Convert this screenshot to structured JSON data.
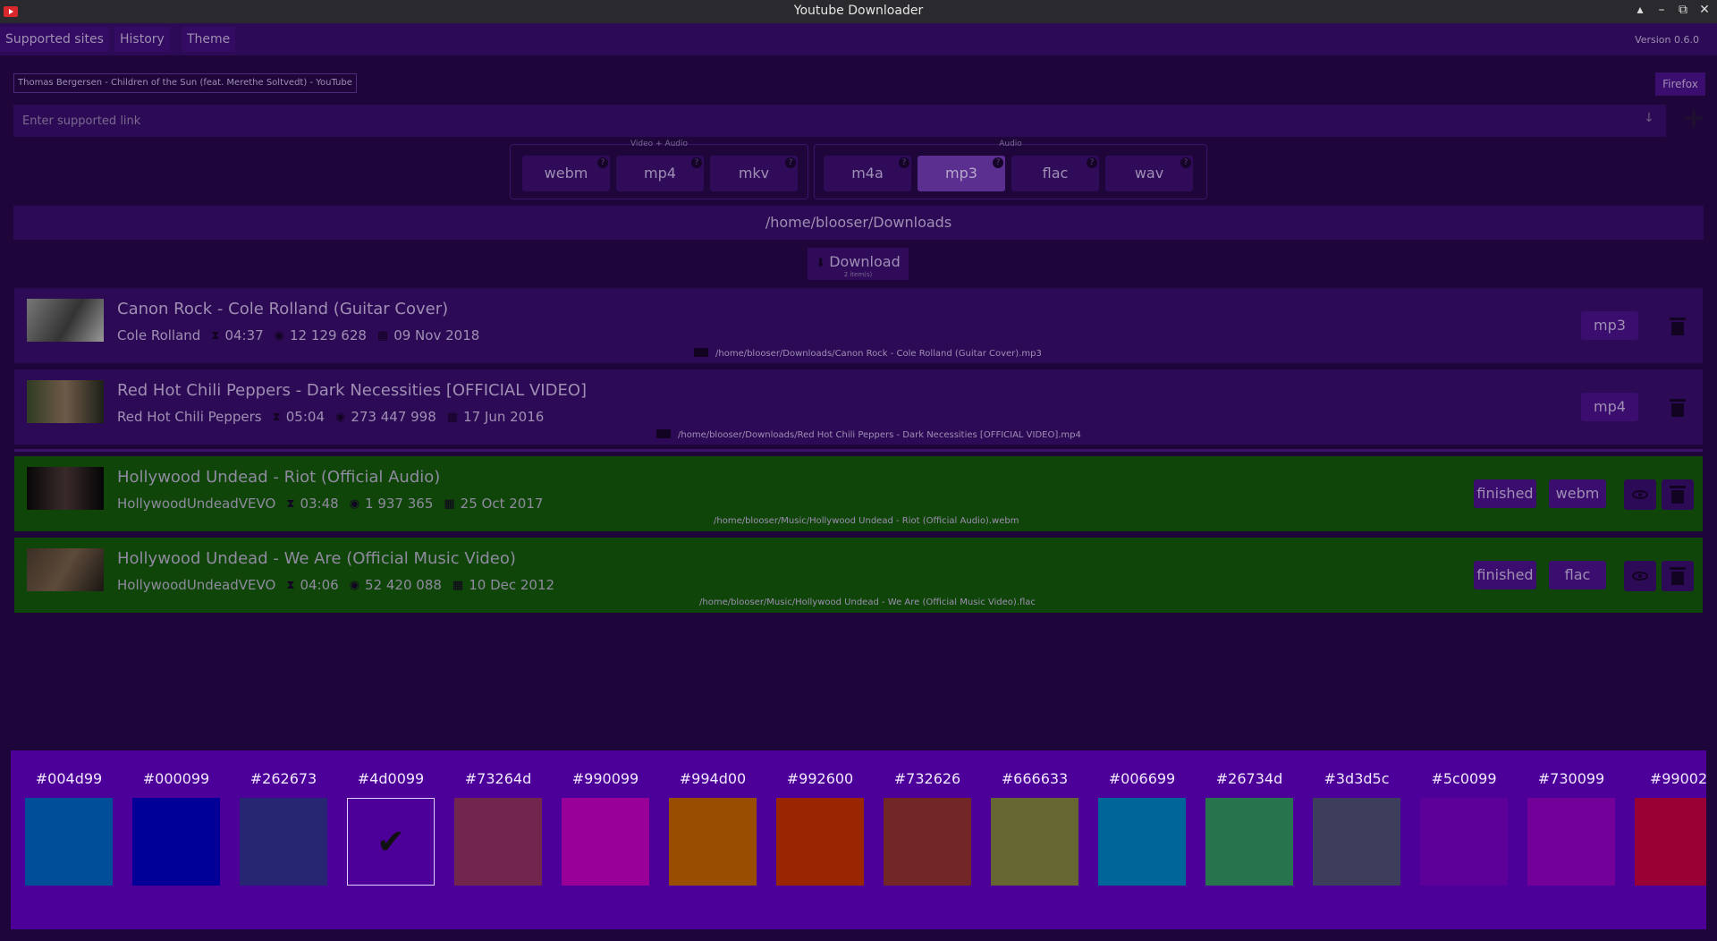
{
  "window": {
    "title": "Youtube Downloader"
  },
  "menu": {
    "supported_sites": "Supported sites",
    "history": "History",
    "theme": "Theme",
    "version": "Version 0.6.0"
  },
  "cookies": {
    "file": "Thomas Bergersen - Children of the Sun (feat. Merethe Soltvedt) - YouTube",
    "browser": "Firefox"
  },
  "link_input": {
    "placeholder": "Enter supported link",
    "value": "",
    "add_label": "+"
  },
  "formats": {
    "video_audio_label": "Video + Audio",
    "audio_label": "Audio",
    "video": [
      "webm",
      "mp4",
      "mkv"
    ],
    "audio": [
      "m4a",
      "mp3",
      "flac",
      "wav"
    ],
    "selected": "mp3",
    "help_glyph": "?"
  },
  "download_dir": "/home/blooser/Downloads",
  "download_button": {
    "label": "Download",
    "count": "2 item(s)"
  },
  "items": [
    {
      "title": "Canon Rock - Cole Rolland (Guitar Cover)",
      "author": "Cole Rolland",
      "duration": "04:37",
      "views": "12 129 628",
      "date": "09 Nov 2018",
      "path": "/home/blooser/Downloads/Canon Rock - Cole Rolland (Guitar Cover).mp3",
      "format": "mp3",
      "status": ""
    },
    {
      "title": "Red Hot Chili Peppers - Dark Necessities [OFFICIAL VIDEO]",
      "author": "Red Hot Chili Peppers",
      "duration": "05:04",
      "views": "273 447 998",
      "date": "17 Jun 2016",
      "path": "/home/blooser/Downloads/Red Hot Chili Peppers - Dark Necessities [OFFICIAL VIDEO].mp4",
      "format": "mp4",
      "status": ""
    },
    {
      "title": "Hollywood Undead - Riot (Official Audio)",
      "author": "HollywoodUndeadVEVO",
      "duration": "03:48",
      "views": "1 937 365",
      "date": "25 Oct 2017",
      "path": "/home/blooser/Music/Hollywood Undead - Riot (Official Audio).webm",
      "format": "webm",
      "status": "finished"
    },
    {
      "title": "Hollywood Undead - We Are (Official Music Video)",
      "author": "HollywoodUndeadVEVO",
      "duration": "04:06",
      "views": "52 420 088",
      "date": "10 Dec 2012",
      "path": "/home/blooser/Music/Hollywood Undead - We Are (Official Music Video).flac",
      "format": "flac",
      "status": "finished"
    }
  ],
  "theme_colors": [
    {
      "label": "#004d99",
      "color": "#004d99"
    },
    {
      "label": "#000099",
      "color": "#000099"
    },
    {
      "label": "#262673",
      "color": "#262673"
    },
    {
      "label": "#4d0099",
      "color": "#4d0099",
      "selected": true
    },
    {
      "label": "#73264d",
      "color": "#73264d"
    },
    {
      "label": "#990099",
      "color": "#990099"
    },
    {
      "label": "#994d00",
      "color": "#994d00"
    },
    {
      "label": "#992600",
      "color": "#992600"
    },
    {
      "label": "#732626",
      "color": "#732626"
    },
    {
      "label": "#666633",
      "color": "#666633"
    },
    {
      "label": "#006699",
      "color": "#006699"
    },
    {
      "label": "#26734d",
      "color": "#26734d"
    },
    {
      "label": "#3d3d5c",
      "color": "#3d3d5c"
    },
    {
      "label": "#5c0099",
      "color": "#5c0099"
    },
    {
      "label": "#730099",
      "color": "#730099"
    },
    {
      "label": "#99002",
      "color": "#990033"
    }
  ],
  "colors": {
    "background": "#1e063b",
    "panel": "#2d0a55",
    "finished": "#0f4508",
    "accent": "#4d0099"
  }
}
